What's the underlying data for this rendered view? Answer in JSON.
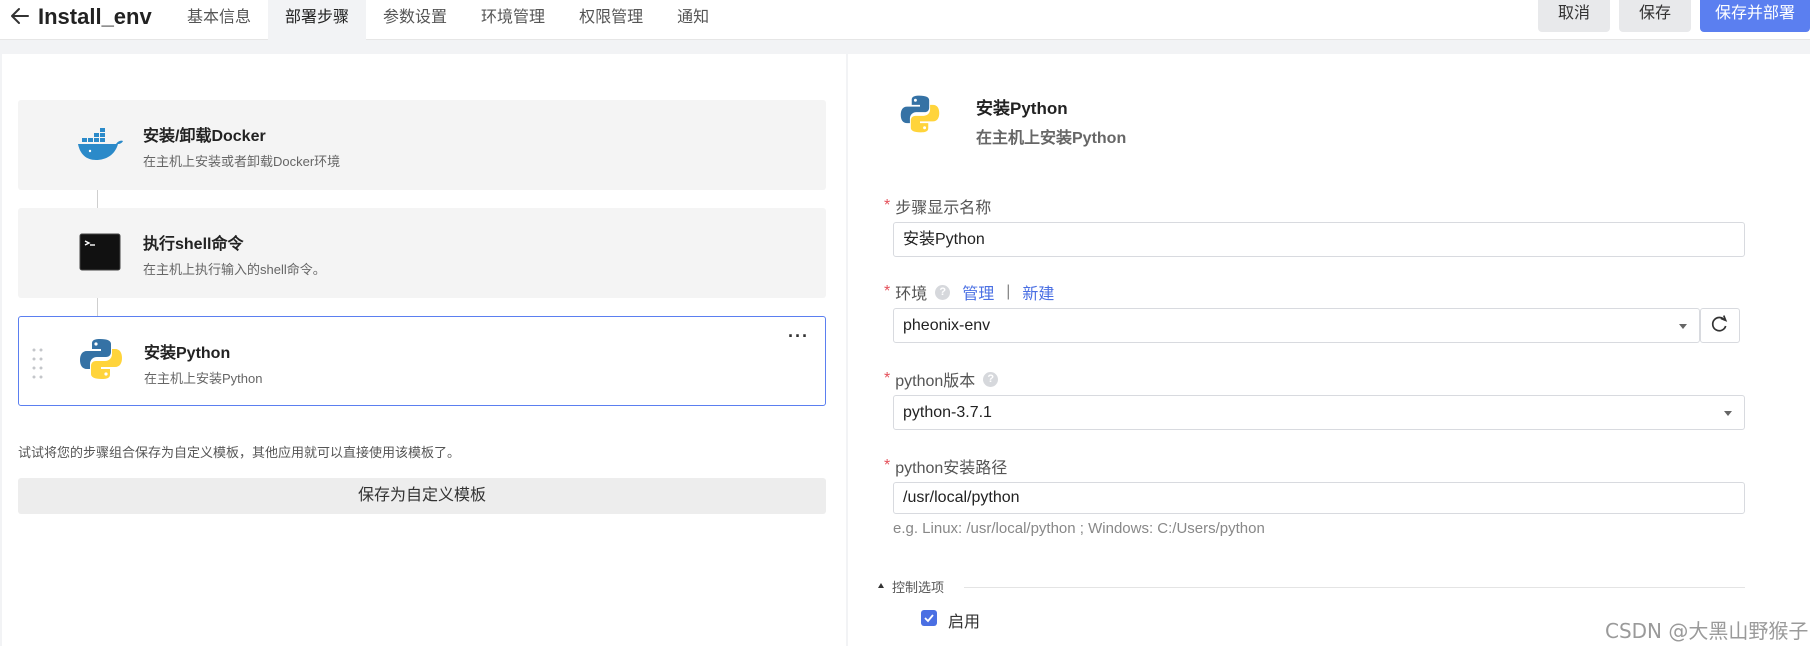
{
  "header": {
    "title": "Install_env",
    "tabs": [
      {
        "label": "基本信息",
        "active": false
      },
      {
        "label": "部署步骤",
        "active": true
      },
      {
        "label": "参数设置",
        "active": false
      },
      {
        "label": "环境管理",
        "active": false
      },
      {
        "label": "权限管理",
        "active": false
      },
      {
        "label": "通知",
        "active": false
      }
    ],
    "cancel_label": "取消",
    "save_label": "保存",
    "save_deploy_label": "保存并部署"
  },
  "steps": [
    {
      "title": "安装/卸载Docker",
      "desc": "在主机上安装或者卸载Docker环境",
      "icon": "docker-icon"
    },
    {
      "title": "执行shell命令",
      "desc": "在主机上执行输入的shell命令。",
      "icon": "terminal-icon"
    },
    {
      "title": "安装Python",
      "desc": "在主机上安装Python",
      "icon": "python-icon",
      "selected": true
    }
  ],
  "template_hint": "试试将您的步骤组合保存为自定义模板，其他应用就可以直接使用该模板了。",
  "template_button": "保存为自定义模板",
  "detail": {
    "title": "安装Python",
    "subtitle": "在主机上安装Python",
    "step_name_label": "步骤显示名称",
    "step_name_value": "安装Python",
    "env_label": "环境",
    "env_manage_link": "管理",
    "env_sep": "|",
    "env_new_link": "新建",
    "env_value": "pheonix-env",
    "python_version_label": "python版本",
    "python_version_value": "python-3.7.1",
    "install_path_label": "python安装路径",
    "install_path_value": "/usr/local/python",
    "install_path_example": "e.g. Linux: /usr/local/python ; Windows: C:/Users/python",
    "control_section_label": "控制选项",
    "enable_label": "启用",
    "enable_checked": true
  },
  "watermark": "CSDN @大黑山野猴子",
  "colors": {
    "accent": "#5b7ff0",
    "link": "#4a6fe3",
    "required": "#e4505a"
  }
}
